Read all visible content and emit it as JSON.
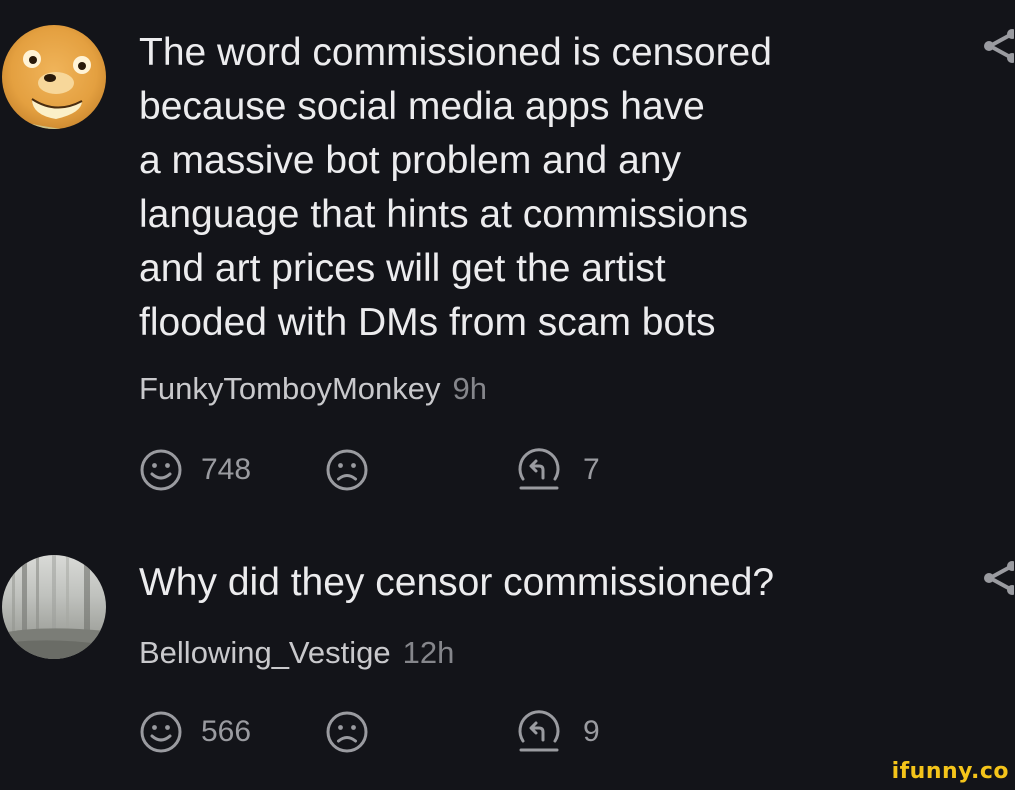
{
  "comments": [
    {
      "text": "The word commissioned is censored\nbecause social media apps have\na massive bot problem and any\nlanguage that hints at commissions\nand art prices will get the artist\nflooded with DMs from scam bots",
      "username": "FunkyTomboyMonkey",
      "time": "9h",
      "likes": "748",
      "replies": "7",
      "avatar": "bear-face-avatar"
    },
    {
      "text": "Why did they censor commissioned?",
      "username": "Bellowing_Vestige",
      "time": "12h",
      "likes": "566",
      "replies": "9",
      "avatar": "foggy-forest-avatar"
    }
  ],
  "icons": {
    "like": "smile-face-icon",
    "dislike": "sad-face-icon",
    "reply": "reply-arrow-icon",
    "share": "share-icon"
  },
  "watermark": "ifunny.co",
  "colors": {
    "background": "#131419",
    "text": "#ececee",
    "muted": "#85868b",
    "watermark": "#f4c41a"
  }
}
